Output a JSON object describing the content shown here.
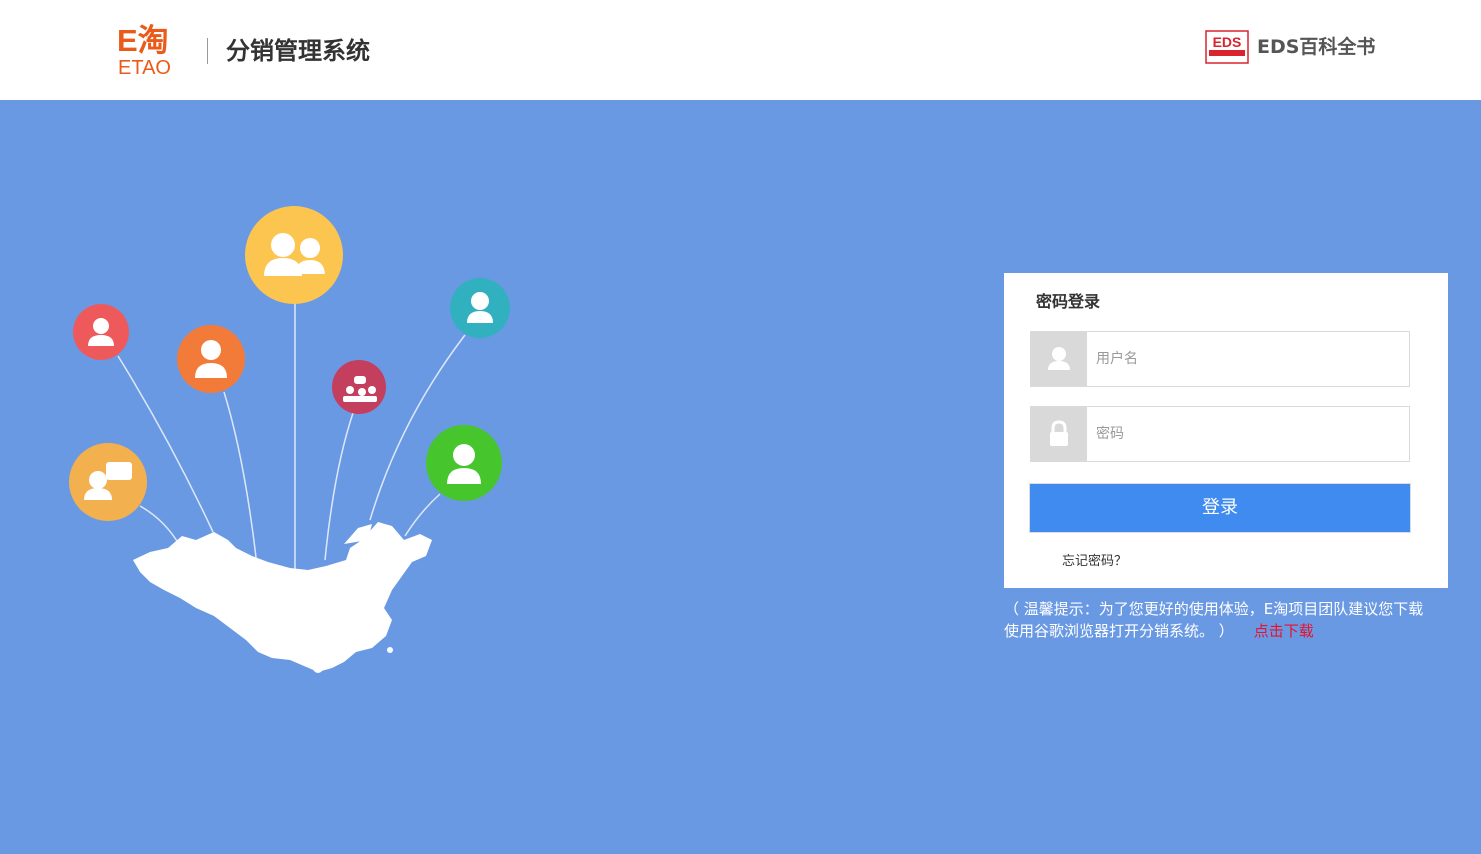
{
  "header": {
    "logo": {
      "main": "E淘",
      "sub": "ETAO"
    },
    "system_title": "分销管理系统",
    "partner": {
      "badge_text": "EDS",
      "title": "EDS百科全书"
    }
  },
  "login": {
    "title": "密码登录",
    "username_placeholder": "用户名",
    "password_placeholder": "密码",
    "submit_label": "登录",
    "forgot_label": "忘记密码？"
  },
  "tip": {
    "line1": "（ 温馨提示：为了您更好的使用体验，E淘项目团队建议您下载",
    "line2": "使用谷歌浏览器打开分销系统。 ）",
    "download_label": "点击下载"
  },
  "colors": {
    "background": "#6a99e4",
    "brand": "#ea5b1a",
    "button": "#3f8bef",
    "link": "#e8112d"
  },
  "illustration": {
    "icons": [
      "user-icon",
      "manager-icon",
      "user-group-icon",
      "support-icon",
      "chat-user-icon",
      "meeting-icon",
      "team-member-icon"
    ]
  }
}
